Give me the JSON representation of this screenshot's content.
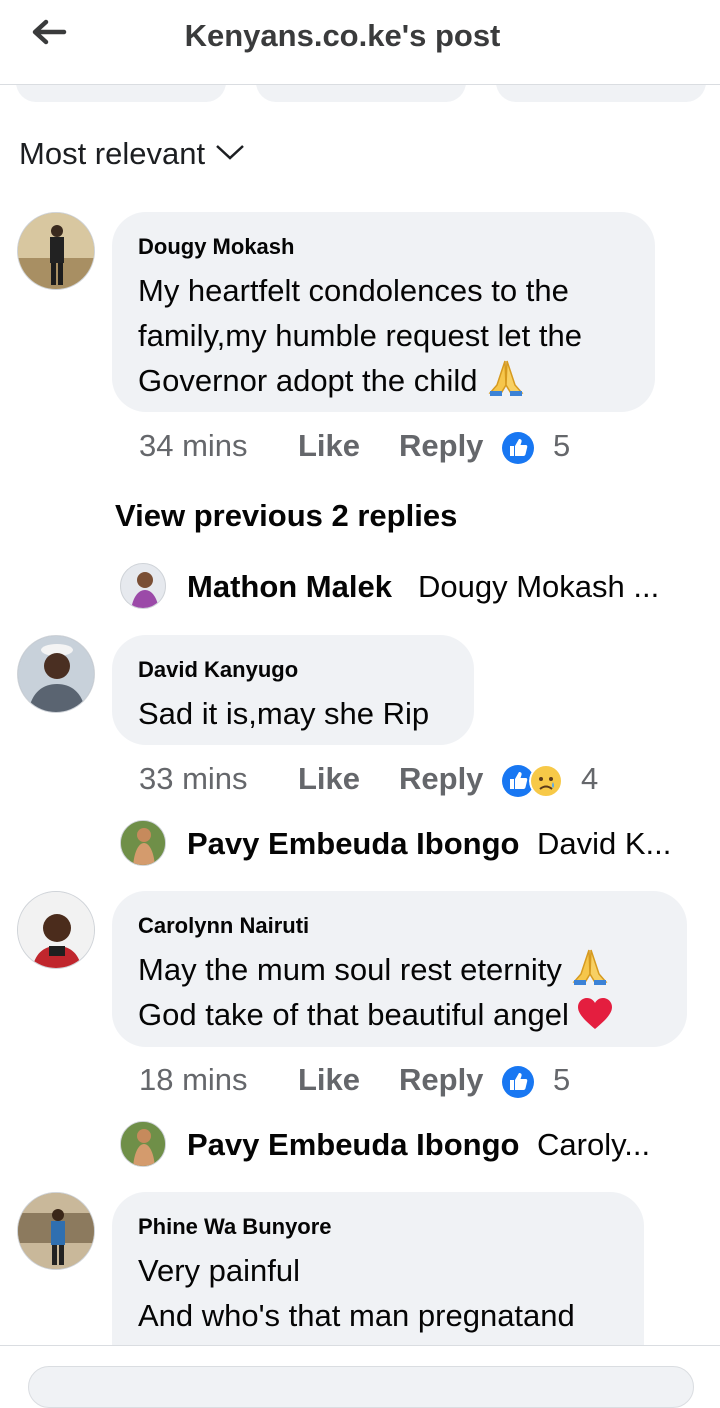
{
  "header": {
    "title": "Kenyans.co.ke's post",
    "back_icon": "back-arrow-icon"
  },
  "sort": {
    "label": "Most relevant"
  },
  "comments": [
    {
      "author": "Dougy Mokash",
      "lines": [
        "My heartfelt condolences to the",
        "family,my humble request let the",
        "Governor adopt the child"
      ],
      "emoji": "folded-hands",
      "time": "34 mins",
      "like": "Like",
      "reply": "Reply",
      "reaction_count": "5",
      "reactions": [
        "like"
      ]
    },
    {
      "author": "David Kanyugo",
      "lines": [
        "Sad it is,may she Rip"
      ],
      "time": "33 mins",
      "like": "Like",
      "reply": "Reply",
      "reaction_count": "4",
      "reactions": [
        "like",
        "sad"
      ]
    },
    {
      "author": "Carolynn Nairuti",
      "lines": [
        "May the mum soul rest eternity",
        "God take of that beautiful angel"
      ],
      "time": "18 mins",
      "like": "Like",
      "reply": "Reply",
      "reaction_count": "5",
      "reactions": [
        "like"
      ]
    },
    {
      "author": "Phine Wa Bunyore",
      "lines": [
        "Very painful",
        "And who's that man pregnatand"
      ]
    }
  ],
  "view_previous": "View previous 2 replies",
  "reply_previews": [
    {
      "name": "Mathon Malek",
      "text": "Dougy Mokash ..."
    },
    {
      "name": "Pavy Embeuda Ibongo",
      "text": "David K..."
    },
    {
      "name": "Pavy Embeuda Ibongo",
      "text": "Caroly..."
    }
  ],
  "colors": {
    "like_blue": "#1877f2",
    "meta_gray": "#65676b",
    "bubble": "#f0f2f5",
    "heart": "#e41e3f"
  }
}
